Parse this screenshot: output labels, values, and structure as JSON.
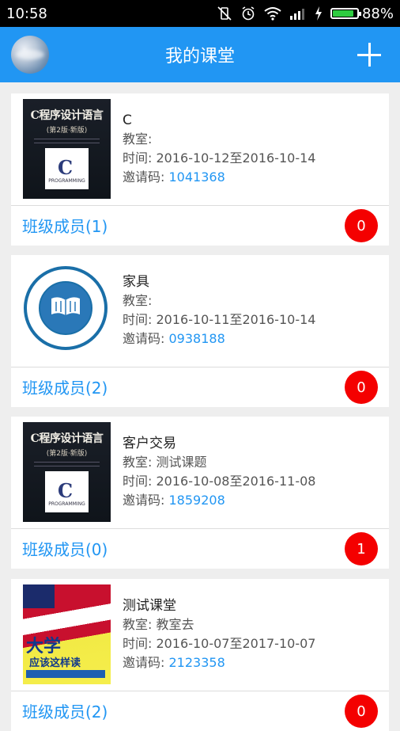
{
  "status_bar": {
    "time": "10:58",
    "battery": "88%",
    "icons": [
      "vibrate-off-icon",
      "alarm-icon",
      "wifi-icon",
      "signal-icon",
      "charging-icon",
      "battery-icon"
    ]
  },
  "app_bar": {
    "title": "我的课堂",
    "avatar_icon": "user-avatar",
    "add_icon": "plus-icon"
  },
  "colors": {
    "app_bar": "#2196f3",
    "link": "#2196f3",
    "badge": "#f40000"
  },
  "classes": [
    {
      "cover_icon": "c-programming-book-cover",
      "name": "C",
      "room_label": "教室:",
      "time_label": "时间: 2016-10-12至2016-10-14",
      "invite_label": "邀请码:",
      "invite_code": "1041368",
      "members": "班级成员(1)",
      "unread": "0"
    },
    {
      "cover_icon": "innovation-education-logo",
      "name": "家具",
      "room_label": "教室:",
      "time_label": "时间: 2016-10-11至2016-10-14",
      "invite_label": "邀请码:",
      "invite_code": "0938188",
      "members": "班级成员(2)",
      "unread": "0"
    },
    {
      "cover_icon": "c-programming-book-cover",
      "name": "客户交易",
      "room_label": "教室:  测试课题",
      "time_label": "时间: 2016-10-08至2016-11-08",
      "invite_label": "邀请码:",
      "invite_code": "1859208",
      "members": "班级成员(0)",
      "unread": "1"
    },
    {
      "cover_icon": "university-book-cover",
      "name": "测试课堂",
      "room_label": "教室:  教室去",
      "time_label": "时间: 2016-10-07至2017-10-07",
      "invite_label": "邀请码:",
      "invite_code": "2123358",
      "members": "班级成员(2)",
      "unread": "0"
    }
  ]
}
